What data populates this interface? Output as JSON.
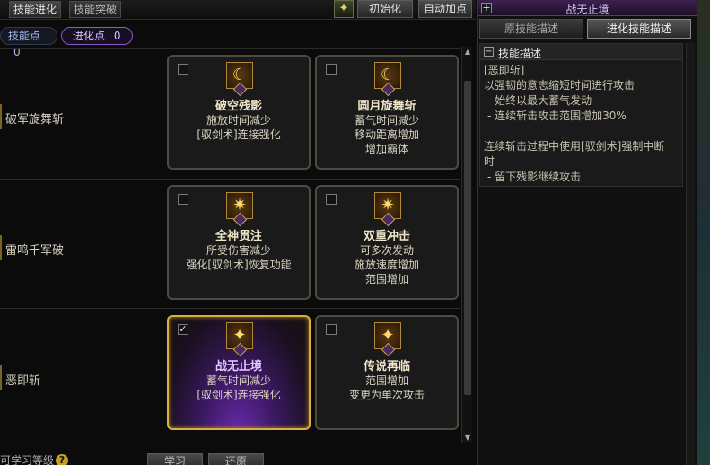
{
  "top": {
    "tabs": [
      "技能进化",
      "技能突破"
    ],
    "reset_label": "初始化",
    "auto_label": "自动加点",
    "auto_icon": "sparkle-wand-icon"
  },
  "points": {
    "skill_label": "技能点",
    "skill_value": "0",
    "evo_label": "进化点",
    "evo_value": "0"
  },
  "rows": [
    {
      "label": "破军旋舞斩",
      "cards": [
        {
          "title": "破空残影",
          "lines": [
            "施放时间减少",
            "[驭剑术]连接强化"
          ],
          "icon": "crescent-moon-icon",
          "rank": "I",
          "checked": false,
          "selected": false
        },
        {
          "title": "圆月旋舞斩",
          "lines": [
            "蓄气时间减少",
            "移动距离增加",
            "增加霸体"
          ],
          "icon": "crescent-moon-icon",
          "rank": "II",
          "checked": false,
          "selected": false
        }
      ]
    },
    {
      "label": "雷鸣千军破",
      "cards": [
        {
          "title": "全神贯注",
          "lines": [
            "所受伤害减少",
            "强化[驭剑术]恢复功能"
          ],
          "icon": "burst-icon",
          "rank": "I",
          "checked": false,
          "selected": false
        },
        {
          "title": "双重冲击",
          "lines": [
            "可多次发动",
            "施放速度增加",
            "范围增加"
          ],
          "icon": "burst-icon",
          "rank": "II",
          "checked": false,
          "selected": false
        }
      ]
    },
    {
      "label": "恶即斩",
      "cards": [
        {
          "title": "战无止境",
          "lines": [
            "蓄气时间减少",
            "[驭剑术]连接强化"
          ],
          "icon": "flame-slash-icon",
          "rank": "I",
          "checked": true,
          "selected": true
        },
        {
          "title": "传说再临",
          "lines": [
            "范围增加",
            "变更为单次攻击"
          ],
          "icon": "flame-slash-icon",
          "rank": "II",
          "checked": false,
          "selected": false
        }
      ]
    }
  ],
  "bottom": {
    "label": "可学习等级",
    "learn_label": "学习",
    "restore_label": "还原"
  },
  "panel": {
    "title": "战无止境",
    "tab_original": "原技能描述",
    "tab_evolved": "进化技能描述",
    "section_title": "技能描述",
    "desc_lines": [
      "[恶即斩]",
      "以强韧的意志缩短时间进行攻击",
      " - 始终以最大蓄气发动",
      " - 连续斩击攻击范围增加30%",
      "",
      "连续斩击过程中使用[驭剑术]强制中断",
      "时",
      " - 留下残影继续攻击"
    ]
  },
  "colors": {
    "selected_border": "#d8b040",
    "evo_pill": "#8a5ac8",
    "selected_glow": "#6a2bb0"
  }
}
